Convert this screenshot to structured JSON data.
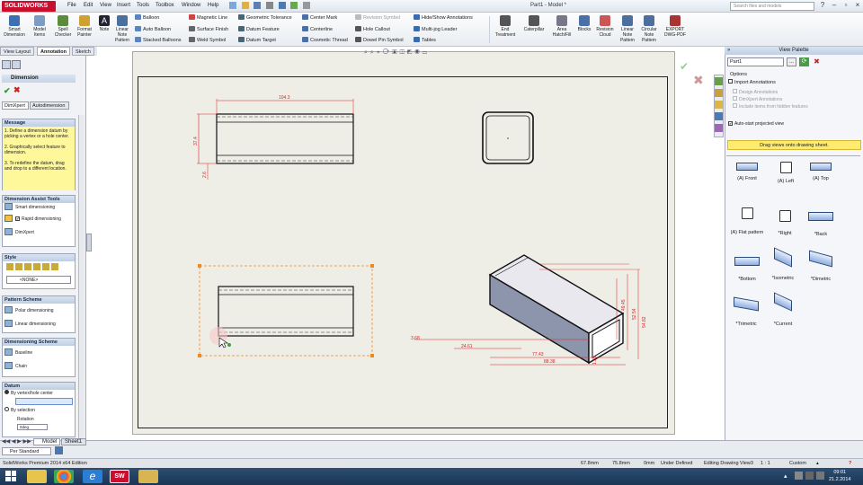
{
  "app": {
    "logo": "SOLIDWORKS",
    "title": "Part1 - Model *",
    "search_placeholder": "Search files and models",
    "window_controls": [
      "?",
      "–",
      "▫",
      "×"
    ]
  },
  "menu": [
    "File",
    "Edit",
    "View",
    "Insert",
    "Tools",
    "Toolbox",
    "Window",
    "Help"
  ],
  "ribbon": {
    "big_buttons": [
      "Smart Dimension",
      "Model Items",
      "Spell Checker",
      "Format Painter",
      "Note",
      "Linear Note Pattern"
    ],
    "col1": [
      "Balloon",
      "Auto Balloon",
      "Stacked Balloons"
    ],
    "col2": [
      "Magnetic Line",
      "Surface Finish",
      "Weld Symbol"
    ],
    "col3": [
      "Geometric Tolerance",
      "Datum Feature",
      "Datum Target"
    ],
    "col4": [
      "Center Mark",
      "Centerline",
      "Cosmetic Thread"
    ],
    "col5": [
      "Revision Symbol",
      "Hole Callout",
      "Dowel Pin Symbol"
    ],
    "col6": [
      "Hide/Show Annotations",
      "Multi-jog Leader",
      "Tables"
    ],
    "right_buttons": [
      "End Treatment",
      "Caterpillar",
      "Area Hatch/Fill",
      "Blocks",
      "Revision Cloud",
      "Linear Note Pattern",
      "Circular Note Pattern",
      "EXPORT DWG-PDF"
    ]
  },
  "command_tabs": [
    "View Layout",
    "Annotation",
    "Sketch"
  ],
  "left_panel": {
    "title": "Dimension",
    "tabs": [
      "DimXpert",
      "Autodimension"
    ],
    "message_head": "Message",
    "message": "1. Define a dimension datum by picking a vertex or a hole center.\n\n2. Graphically select feature to dimension.\n\n3. To redefine the datum, drag and drop to a different location.",
    "assist_head": "Dimension Assist Tools",
    "assist_items": [
      "Smart dimensioning",
      "Rapid dimensioning",
      "DimXpert"
    ],
    "style_head": "Style",
    "style_value": "<NONE>",
    "pattern_head": "Pattern Scheme",
    "pattern_items": [
      "Polar dimensioning",
      "Linear dimensioning"
    ],
    "scheme_head": "Dimensioning Scheme",
    "scheme_items": [
      "Baseline",
      "Chain"
    ],
    "datum_head": "Datum",
    "datum_opt1": "By vertex/hole center",
    "datum_opt2": "By selection",
    "rotation": "Rotation",
    "rotation_value": "0deg"
  },
  "drawing": {
    "dims_front": {
      "width": "104.3",
      "height": "37.4",
      "small": "2.6"
    },
    "dims_iso": [
      "3.68",
      "24.61",
      "77.43",
      "88.38",
      "49.45",
      "52.54",
      "54.82",
      "1.35"
    ]
  },
  "right_panel": {
    "title": "View Palette",
    "doc": "Part1",
    "options_label": "Options",
    "import_annotations": "Import Annotations",
    "design_annotations": "Design Annotations",
    "dimxpert_annotations": "DimXpert Annotations",
    "hidden_features": "Include items from hidden features",
    "auto_start": "Auto-start projected view",
    "drag_hint": "Drag views onto drawing sheet.",
    "views": [
      "(A) Front",
      "(A) Left",
      "(A) Top",
      "(A) Flat pattern",
      "*Right",
      "*Back",
      "*Bottom",
      "*Isometric",
      "*Dimetric",
      "*Trimetric",
      "*Current"
    ]
  },
  "bottom": {
    "model_tab": "Model",
    "sheet_tab": "Sheet1",
    "scale": "Per Standard"
  },
  "status": {
    "product": "SolidWorks Premium 2014 x64 Edition",
    "x": "67.8mm",
    "y": "75.8mm",
    "z": "0mm",
    "state": "Under Defined",
    "editing": "Editing Drawing View3",
    "scale": "1 : 1",
    "units": "Custom"
  },
  "clock": {
    "time": "09:01",
    "date": "21.2.2014"
  },
  "colors": {
    "accent_red": "#c8102e",
    "dim_red": "#dd2222",
    "message_yellow": "#fff89a",
    "taskbar": "#1a3553"
  }
}
